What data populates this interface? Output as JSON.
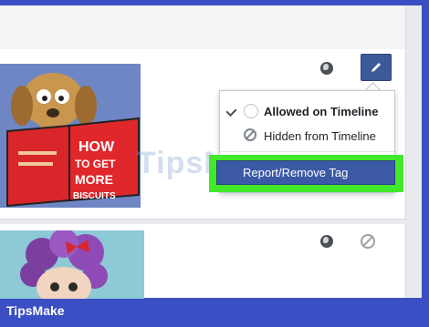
{
  "menu": {
    "allowed_label": "Allowed on Timeline",
    "hidden_label": "Hidden from Timeline",
    "report_label": "Report/Remove Tag"
  },
  "book": {
    "line1": "HOW",
    "line2": "TO GET",
    "line3": "MORE",
    "line4": "BISCUITS"
  },
  "watermark": "TipsMake",
  "brand": "TipsMake",
  "colors": {
    "frame": "#3b4fc4",
    "edit_button": "#3d5a98",
    "highlight": "#42e82a",
    "report_button": "#3c59a6"
  }
}
